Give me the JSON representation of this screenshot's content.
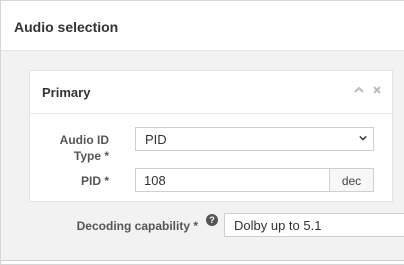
{
  "dialog": {
    "title": "Audio selection"
  },
  "primary": {
    "title": "Primary",
    "audio_id_type": {
      "label_line1": "Audio ID",
      "label_line2": "Type *",
      "value": "PID"
    },
    "pid": {
      "label": "PID *",
      "value": "108",
      "unit": "dec"
    }
  },
  "decoding": {
    "label": "Decoding capability *",
    "value": "Dolby up to 5.1"
  }
}
